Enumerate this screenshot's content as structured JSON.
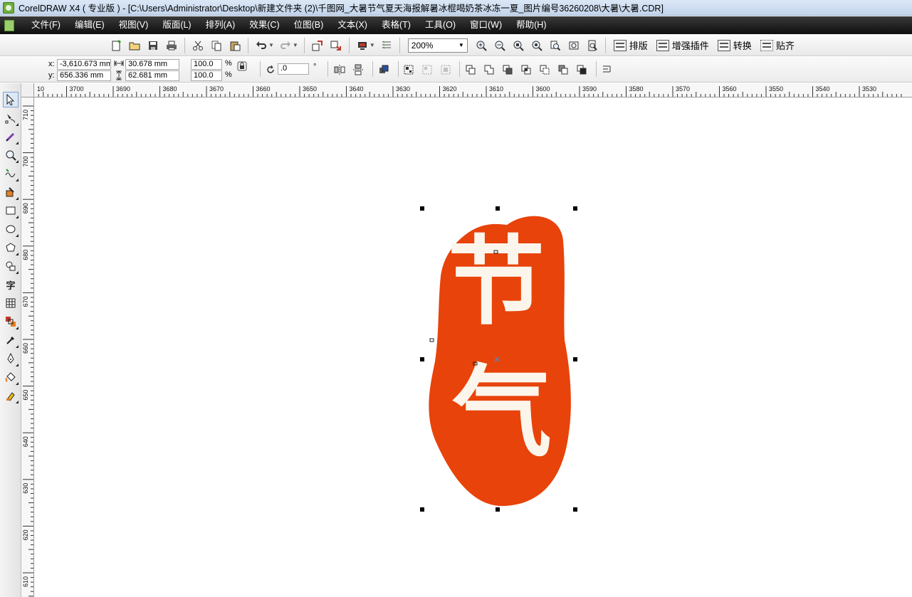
{
  "window": {
    "title": "CorelDRAW X4 ( 专业版 ) - [C:\\Users\\Administrator\\Desktop\\新建文件夹 (2)\\千图网_大暑节气夏天海报解暑冰棍喝奶茶冰冻一夏_图片编号36260208\\大暑\\大暑.CDR]"
  },
  "menu": {
    "items": [
      "文件(F)",
      "编辑(E)",
      "视图(V)",
      "版面(L)",
      "排列(A)",
      "效果(C)",
      "位图(B)",
      "文本(X)",
      "表格(T)",
      "工具(O)",
      "窗口(W)",
      "帮助(H)"
    ]
  },
  "toolbar": {
    "zoom": "200%",
    "plugins": [
      "排版",
      "增强插件",
      "转换",
      "贴齐"
    ]
  },
  "property_bar": {
    "x_label": "x:",
    "y_label": "y:",
    "x_value": "-3,610.673 mm",
    "y_value": "656.336 mm",
    "width_value": "30.678 mm",
    "height_value": "62.681 mm",
    "scale_x": "100.0",
    "scale_y": "100.0",
    "percent": "%",
    "rotation": ".0",
    "degree": "°"
  },
  "rulers": {
    "horizontal": [
      "10",
      "3700",
      "3690",
      "3680",
      "3670",
      "3660",
      "3650",
      "3640",
      "3630",
      "3620",
      "3610",
      "3600",
      "3590",
      "3580",
      "3570",
      "3560",
      "3550",
      "3540",
      "3530"
    ],
    "vertical": [
      "710",
      "700",
      "690",
      "680",
      "670",
      "660",
      "650",
      "640",
      "630",
      "620",
      "610"
    ]
  },
  "artwork": {
    "stamp_color": "#e8430a",
    "glyph_color": "#fbf5ec",
    "text_top": "节",
    "text_bottom": "气"
  },
  "colors": {
    "menubar": "#1a1a1a",
    "handle": "#000000"
  }
}
